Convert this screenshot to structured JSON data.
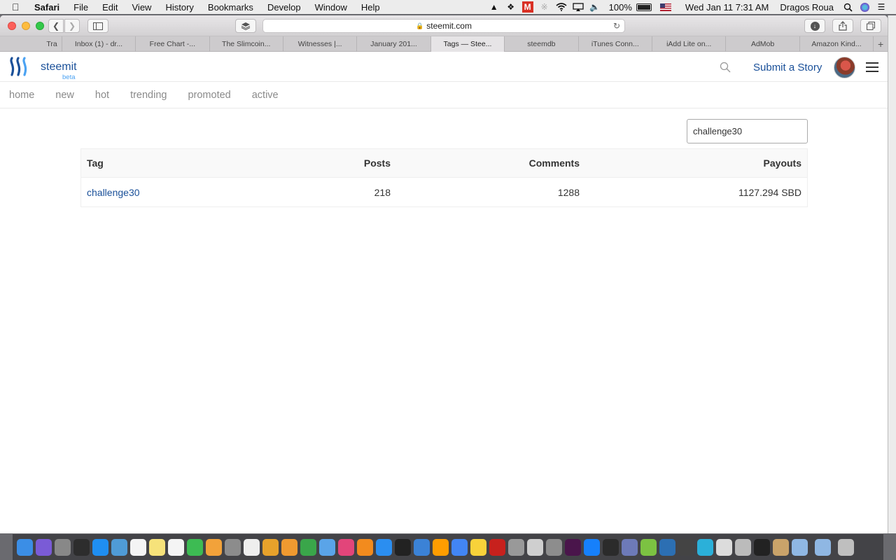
{
  "menubar": {
    "app_name": "Safari",
    "menus": [
      "File",
      "Edit",
      "View",
      "History",
      "Bookmarks",
      "Develop",
      "Window",
      "Help"
    ],
    "battery_text": "100%",
    "clock": "Wed Jan 11  7:31 AM",
    "user_name": "Dragos Roua"
  },
  "browser": {
    "url": "steemit.com",
    "tabs": [
      "Tra",
      "Inbox (1) - dr...",
      "Free Chart -...",
      "The Slimcoin...",
      "Witnesses |...",
      "January 201...",
      "Tags — Stee...",
      "steemdb",
      "iTunes Conn...",
      "iAdd Lite on...",
      "AdMob",
      "Amazon Kind..."
    ],
    "active_tab_index": 6
  },
  "site": {
    "brand": "steemit",
    "beta_label": "beta",
    "submit_label": "Submit a Story",
    "nav": [
      "home",
      "new",
      "hot",
      "trending",
      "promoted",
      "active"
    ],
    "colors": {
      "brand": "#1a5099",
      "beta": "#4ba2f2",
      "nav_text": "#8a8a8a"
    }
  },
  "tags": {
    "filter_value": "challenge30",
    "columns": [
      "Tag",
      "Posts",
      "Comments",
      "Payouts"
    ],
    "rows": [
      {
        "tag": "challenge30",
        "posts": "218",
        "comments": "1288",
        "payouts": "1127.294 SBD"
      }
    ]
  },
  "dock": {
    "icons": [
      "finder-icon",
      "siri-icon",
      "launchpad-icon",
      "mission-control-icon",
      "safari-icon",
      "preview-icon",
      "calendar-icon",
      "notes-icon",
      "reminders-icon",
      "facetime-icon",
      "photos-icon",
      "system-preferences-icon",
      "textedit-icon",
      "keynote-icon",
      "pages-icon",
      "numbers-icon",
      "keynote-remote-icon",
      "itunes-icon",
      "ibooks-icon",
      "app-store-icon",
      "terminal-icon",
      "xcode-icon",
      "sublime-icon",
      "chrome-icon",
      "cyberduck-icon",
      "filezilla-icon",
      "dvd-player-icon",
      "image-capture-icon",
      "automator-icon",
      "slack-icon",
      "shazam-icon",
      "kindle-icon",
      "ethereum-icon",
      "money-icon",
      "affinity-icon",
      "jx-icon",
      "vectornator-icon",
      "helix-icon",
      "script-editor-icon",
      "console-icon",
      "notebook-icon",
      "downloads-icon",
      "documents-icon",
      "trash-icon"
    ]
  }
}
